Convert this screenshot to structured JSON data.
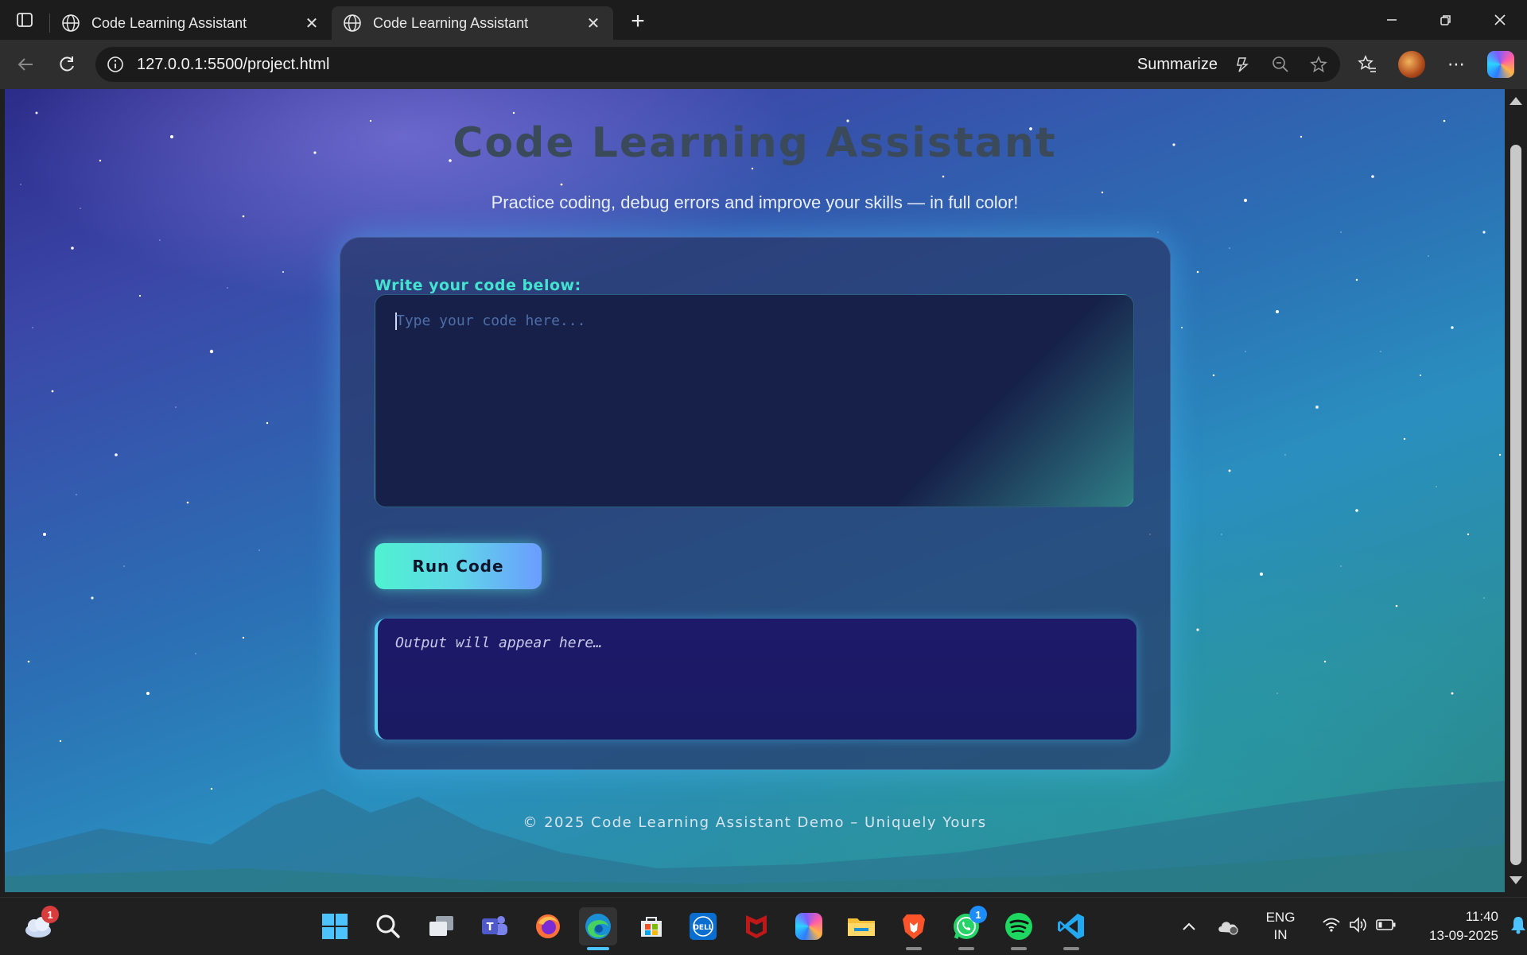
{
  "browser": {
    "tabs": [
      {
        "title": "Code Learning Assistant",
        "active": false
      },
      {
        "title": "Code Learning Assistant",
        "active": true
      }
    ],
    "url": "127.0.0.1:5500/project.html",
    "summarize_label": "Summarize"
  },
  "page": {
    "title": "Code Learning Assistant",
    "subtitle": "Practice coding, debug errors and improve your skills — in full color!",
    "code_label": "Write your code below:",
    "code_placeholder": "Type your code here...",
    "run_button": "Run Code",
    "output_text": "Output will appear here…",
    "footer": "© 2025 Code Learning Assistant Demo – Uniquely Yours"
  },
  "taskbar": {
    "weather_badge": "1",
    "whatsapp_badge": "1",
    "lang_line1": "ENG",
    "lang_line2": "IN",
    "time": "11:40",
    "date": "13-09-2025"
  },
  "colors": {
    "accent_teal": "#44e3d0",
    "button_gradient_start": "#4ff2d0",
    "button_gradient_end": "#6b9cff",
    "output_bg": "#1d1a6a"
  },
  "icons": [
    "tab-actions-icon",
    "globe-icon",
    "close-icon",
    "plus-icon",
    "minimize-icon",
    "restore-icon",
    "back-icon",
    "refresh-icon",
    "info-icon",
    "copilot-summarize-icon",
    "zoom-out-icon",
    "favorite-star-icon",
    "favorites-icon",
    "profile-avatar",
    "more-icon",
    "copilot-icon",
    "weather-icon",
    "windows-start-icon",
    "search-icon",
    "task-view-icon",
    "teams-icon",
    "firefox-icon",
    "edge-icon",
    "store-icon",
    "dell-icon",
    "mcafee-icon",
    "copilot-app-icon",
    "file-explorer-icon",
    "brave-icon",
    "whatsapp-icon",
    "spotify-icon",
    "vscode-icon",
    "chevron-up-icon",
    "onedrive-icon",
    "wifi-icon",
    "volume-icon",
    "battery-icon",
    "notification-bell-icon"
  ]
}
